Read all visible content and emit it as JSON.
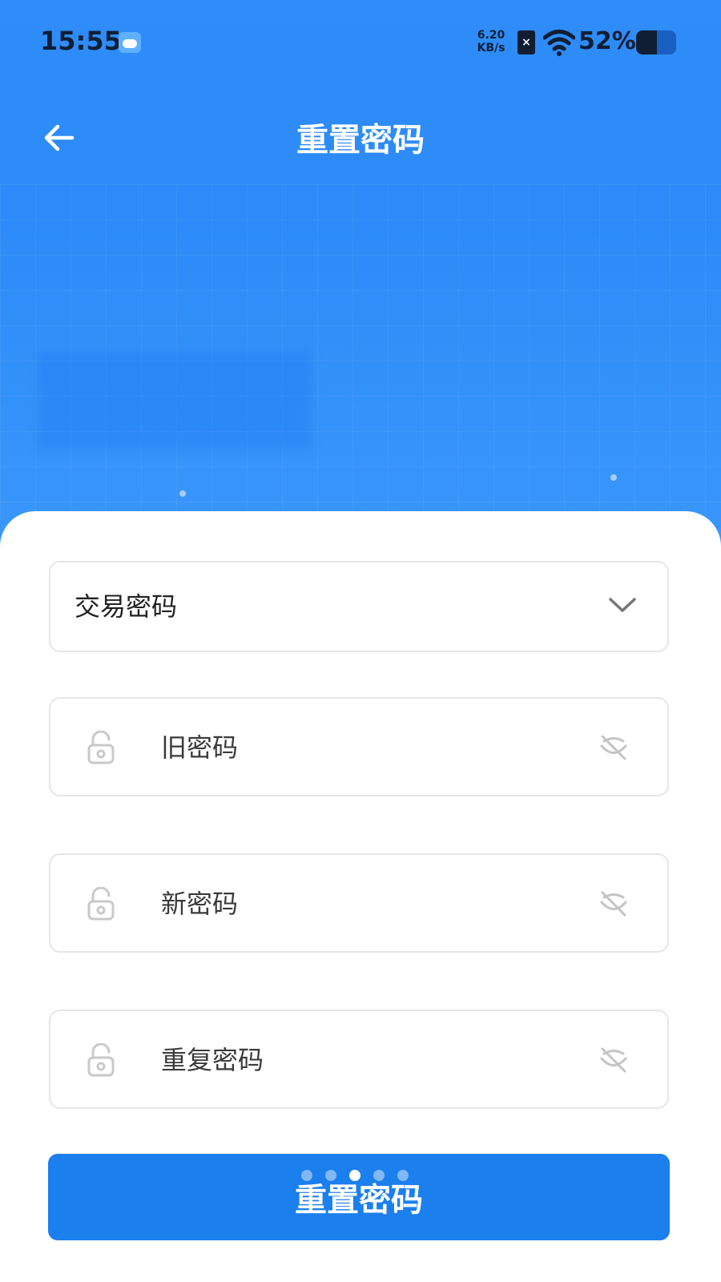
{
  "status_bar": {
    "time": "15:55",
    "net_speed_value": "6.20",
    "net_speed_unit": "KB/s",
    "battery_percent": "52%",
    "battery_level": 0.52
  },
  "header": {
    "title": "重置密码"
  },
  "form": {
    "password_type": "交易密码",
    "old_password_placeholder": "旧密码",
    "new_password_placeholder": "新密码",
    "repeat_password_placeholder": "重复密码",
    "submit_label": "重置密码"
  },
  "pager": {
    "count": 5,
    "active_index": 2
  },
  "colors": {
    "header_blue": "#2f8cf8",
    "button_blue": "#1b7fee",
    "border": "#e6e6e6"
  }
}
